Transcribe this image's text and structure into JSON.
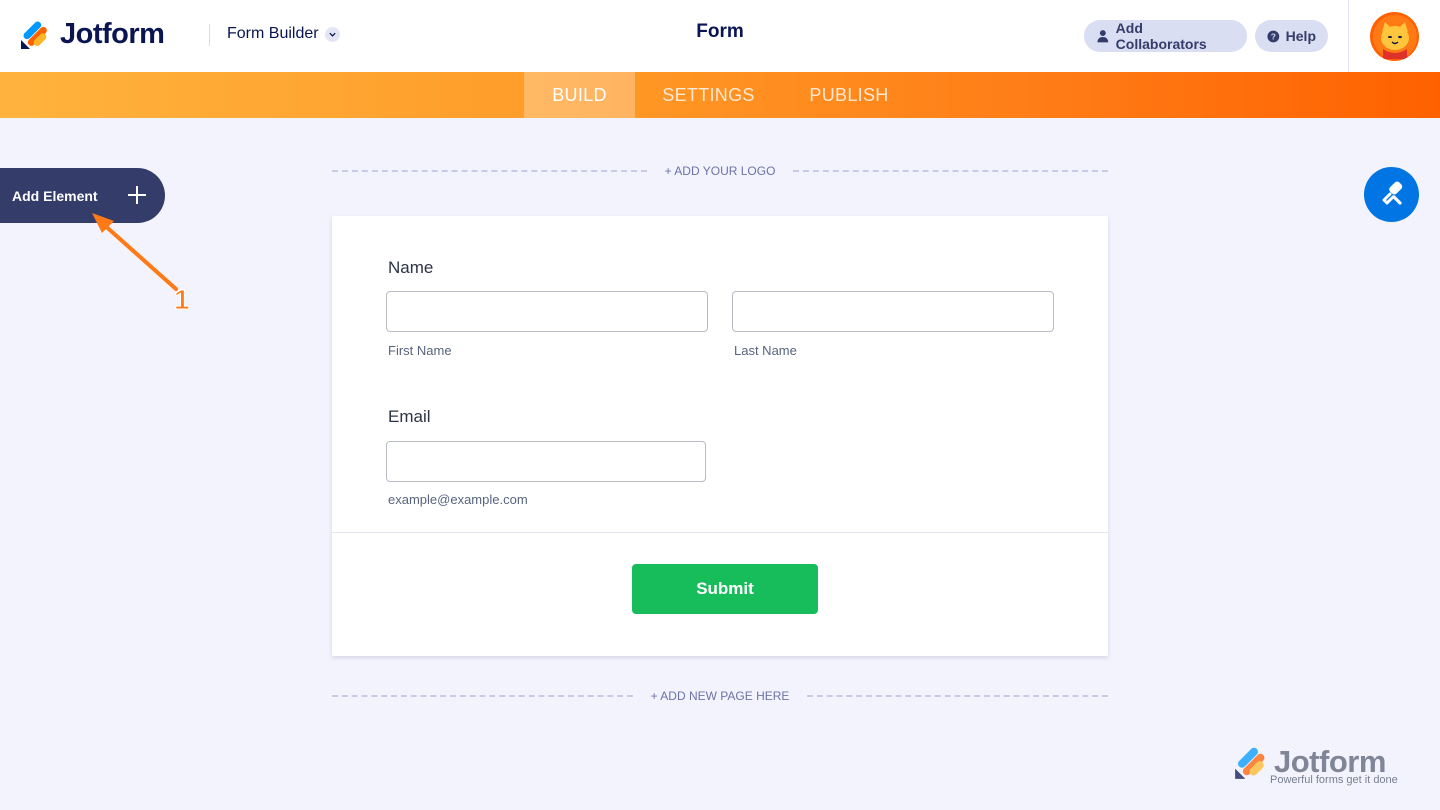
{
  "header": {
    "brand": "Jotform",
    "builder_menu": "Form Builder",
    "title": "Form",
    "collaborators_label": "Add Collaborators",
    "help_label": "Help"
  },
  "nav": {
    "tabs": [
      {
        "label": "BUILD",
        "active": true
      },
      {
        "label": "SETTINGS",
        "active": false
      },
      {
        "label": "PUBLISH",
        "active": false
      }
    ]
  },
  "sidebar": {
    "add_element_label": "Add Element"
  },
  "annotation": {
    "number": "1"
  },
  "canvas": {
    "add_logo_label": "+ ADD YOUR LOGO",
    "add_page_label": "+ ADD NEW PAGE HERE"
  },
  "form": {
    "name_label": "Name",
    "first_name_sublabel": "First Name",
    "last_name_sublabel": "Last Name",
    "email_label": "Email",
    "email_sublabel": "example@example.com",
    "submit_label": "Submit"
  },
  "watermark": {
    "brand": "Jotform",
    "tagline": "Powerful forms get it done"
  },
  "colors": {
    "accent_orange": "#ff6100",
    "navy": "#0a1551",
    "submit_green": "#18bd5b",
    "designer_blue": "#0075e3"
  }
}
